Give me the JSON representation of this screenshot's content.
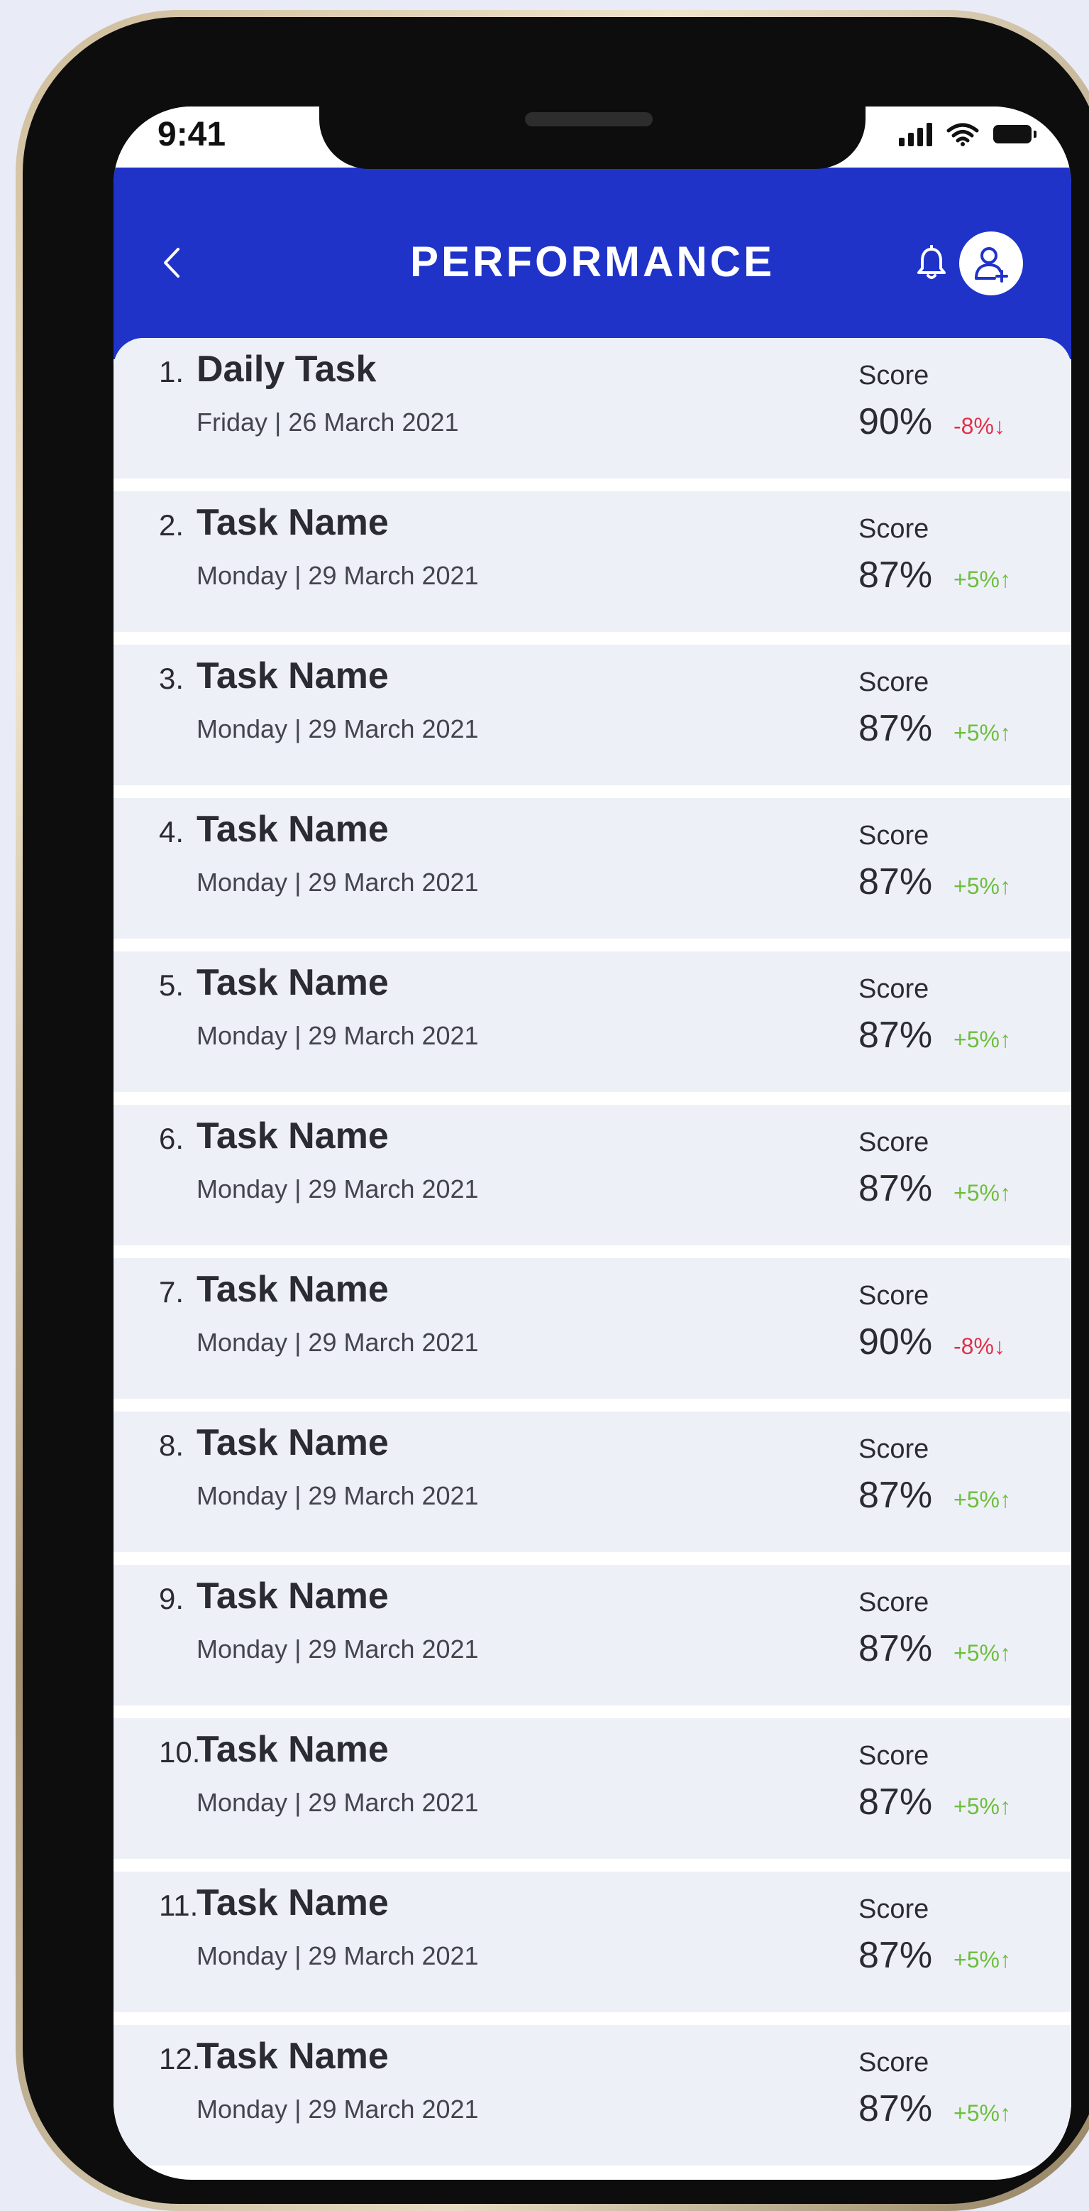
{
  "status_bar": {
    "time": "9:41",
    "icons": [
      "signal-icon",
      "wifi-icon",
      "battery-icon"
    ]
  },
  "header": {
    "title": "PERFORMANCE",
    "background_color": "#1f33c9",
    "icons": [
      "chevron-left-icon",
      "bell-icon",
      "user-add-icon"
    ]
  },
  "colors": {
    "change_down": "#e0314a",
    "change_up": "#6cbf3c",
    "row_background": "#eef0f7"
  },
  "tasks": [
    {
      "number": "1.",
      "name": "Daily Task",
      "date": "Friday | 26 March 2021",
      "score_label": "Score",
      "score": "90%",
      "change": "-8%↓",
      "trend": "down"
    },
    {
      "number": "2.",
      "name": "Task Name",
      "date": "Monday | 29 March 2021",
      "score_label": "Score",
      "score": "87%",
      "change": "+5%↑",
      "trend": "up"
    },
    {
      "number": "3.",
      "name": "Task Name",
      "date": "Monday | 29 March 2021",
      "score_label": "Score",
      "score": "87%",
      "change": "+5%↑",
      "trend": "up"
    },
    {
      "number": "4.",
      "name": "Task Name",
      "date": "Monday | 29 March 2021",
      "score_label": "Score",
      "score": "87%",
      "change": "+5%↑",
      "trend": "up"
    },
    {
      "number": "5.",
      "name": "Task Name",
      "date": "Monday | 29 March 2021",
      "score_label": "Score",
      "score": "87%",
      "change": "+5%↑",
      "trend": "up"
    },
    {
      "number": "6.",
      "name": "Task Name",
      "date": "Monday | 29 March 2021",
      "score_label": "Score",
      "score": "87%",
      "change": "+5%↑",
      "trend": "up"
    },
    {
      "number": "7.",
      "name": "Task Name",
      "date": "Monday | 29 March 2021",
      "score_label": "Score",
      "score": "90%",
      "change": "-8%↓",
      "trend": "down"
    },
    {
      "number": "8.",
      "name": "Task Name",
      "date": "Monday | 29 March 2021",
      "score_label": "Score",
      "score": "87%",
      "change": "+5%↑",
      "trend": "up"
    },
    {
      "number": "9.",
      "name": "Task Name",
      "date": "Monday | 29 March 2021",
      "score_label": "Score",
      "score": "87%",
      "change": "+5%↑",
      "trend": "up"
    },
    {
      "number": "10.",
      "name": "Task Name",
      "date": "Monday | 29 March 2021",
      "score_label": "Score",
      "score": "87%",
      "change": "+5%↑",
      "trend": "up"
    },
    {
      "number": "11.",
      "name": "Task Name",
      "date": "Monday | 29 March 2021",
      "score_label": "Score",
      "score": "87%",
      "change": "+5%↑",
      "trend": "up"
    },
    {
      "number": "12.",
      "name": "Task Name",
      "date": "Monday | 29 March 2021",
      "score_label": "Score",
      "score": "87%",
      "change": "+5%↑",
      "trend": "up"
    }
  ]
}
